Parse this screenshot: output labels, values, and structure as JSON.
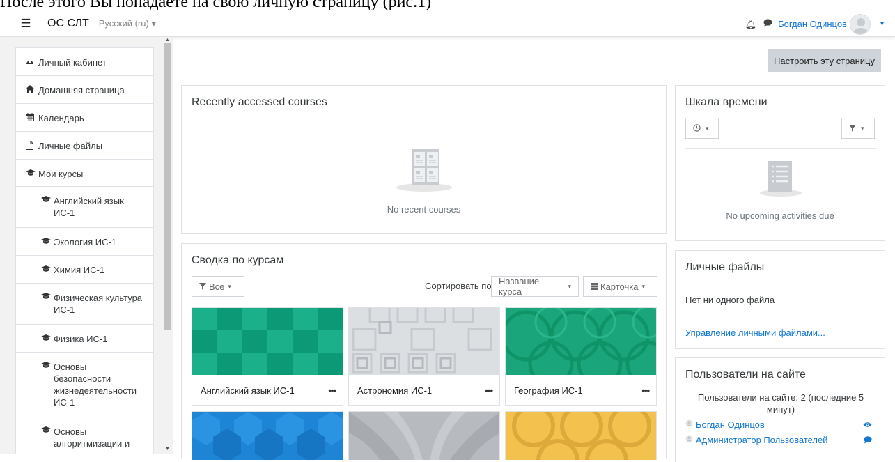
{
  "caption": "После этого Вы попадаете на свою личную страницу (рис.1)",
  "navbar": {
    "brand": "ОС СЛТ",
    "language": "Русский (ru)",
    "user_name": "Богдан Одинцов"
  },
  "drawer": {
    "items": [
      {
        "label": "Личный кабинет",
        "icon": "dashboard-icon"
      },
      {
        "label": "Домашняя страница",
        "icon": "home-icon"
      },
      {
        "label": "Календарь",
        "icon": "calendar-icon"
      },
      {
        "label": "Личные файлы",
        "icon": "file-icon"
      },
      {
        "label": "Мои курсы",
        "icon": "graduation-cap-icon"
      }
    ],
    "courses": [
      {
        "label": "Английский язык ИС-1"
      },
      {
        "label": "Экология ИС-1"
      },
      {
        "label": "Химия ИС-1"
      },
      {
        "label": "Физическая культура ИС-1"
      },
      {
        "label": "Физика ИС-1"
      },
      {
        "label": "Основы безопасности жизнедеятельности ИС-1"
      },
      {
        "label": "Основы алгоритмизации и программирования"
      }
    ]
  },
  "customize_button": "Настроить эту страницу",
  "recent": {
    "title": "Recently accessed courses",
    "empty_text": "No recent courses"
  },
  "overview": {
    "title": "Сводка по курсам",
    "filter_label": "Все",
    "sort_prefix": "Сортировать по",
    "sort_value": "Название курса",
    "view_value": "Карточка",
    "courses": [
      {
        "name": "Английский язык ИС-1",
        "color": "#10a57f"
      },
      {
        "name": "Астрономия ИС-1",
        "color": "#d9dcdf"
      },
      {
        "name": "География ИС-1",
        "color": "#1aa67a"
      }
    ],
    "next_row_colors": [
      "#1d84d6",
      "#b7bbbf",
      "#f2c14e"
    ]
  },
  "timeline": {
    "title": "Шкала времени",
    "empty_text": "No upcoming activities due"
  },
  "files": {
    "title": "Личные файлы",
    "empty_text": "Нет ни одного файла",
    "manage_link": "Управление личными файлами..."
  },
  "online": {
    "title": "Пользователи на сайте",
    "summary": "Пользователи на сайте: 2 (последние 5 минут)",
    "users": [
      {
        "name": "Богдан Одинцов",
        "action_icon": "eye-icon"
      },
      {
        "name": "Администратор Пользователей",
        "action_icon": "message-icon"
      }
    ]
  },
  "colors": {
    "accent": "#1177d1",
    "drawer_bg": "#f2f2f2",
    "border": "#dfe2e5"
  }
}
